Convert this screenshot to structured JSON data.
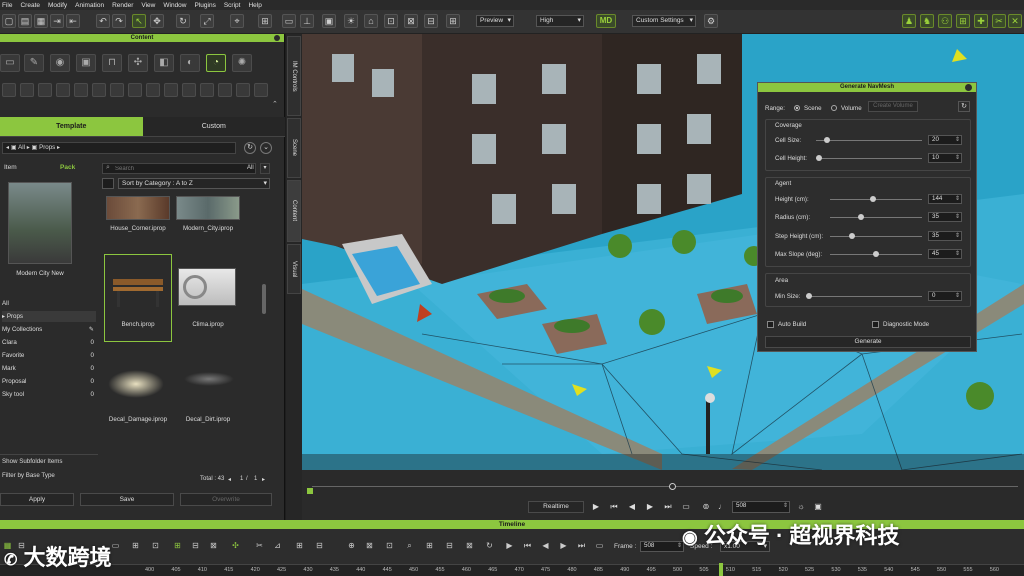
{
  "menu": [
    "File",
    "Create",
    "Modify",
    "Animation",
    "Render",
    "View",
    "Window",
    "Plugins",
    "Script",
    "Help"
  ],
  "toolbar": {
    "render_mode": "Preview",
    "quality": "High",
    "settings": "Custom Settings",
    "logo": "MD"
  },
  "content_panel": {
    "title": "Content",
    "tabs": [
      "Template",
      "Custom"
    ],
    "breadcrumb": [
      "All",
      "Props"
    ],
    "view_tabs": [
      "Item",
      "Pack"
    ],
    "search_placeholder": "Search",
    "search_filter": "All",
    "sort": "Sort by Category : A to Z",
    "preview_label": "Modern City New",
    "tree": [
      {
        "label": "All",
        "count": ""
      },
      {
        "label": "Props",
        "count": ""
      },
      {
        "label": "My Collections",
        "count": ""
      },
      {
        "label": "Clara",
        "count": "0"
      },
      {
        "label": "Favorite",
        "count": "0"
      },
      {
        "label": "Mark",
        "count": "0"
      },
      {
        "label": "Proposal",
        "count": "0"
      },
      {
        "label": "Sky tool",
        "count": "0"
      }
    ],
    "items": [
      {
        "label": "House_Corner.iprop"
      },
      {
        "label": "Modern_City.iprop"
      },
      {
        "label": "Bench.iprop"
      },
      {
        "label": "Clima.iprop"
      },
      {
        "label": "Decal_Damage.iprop"
      },
      {
        "label": "Decal_Dirt.iprop"
      }
    ],
    "show_subfolder": "Show Subfolder Items",
    "filter_base": "Filter by Base Type",
    "total": "Total : 43",
    "page": "1",
    "pages": "1",
    "page_sep": "/",
    "buttons": {
      "apply": "Apply",
      "save": "Save",
      "overwrite": "Overwrite"
    }
  },
  "side_tabs": [
    "IM Controls",
    "Scene",
    "Content",
    "Visual"
  ],
  "navmesh": {
    "title": "Generate NavMesh",
    "range_label": "Range:",
    "range_options": [
      "Scene",
      "Volume"
    ],
    "create_volume": "Create Volume",
    "coverage_title": "Coverage",
    "coverage": [
      {
        "label": "Cell Size:",
        "value": "20",
        "frac": 0.08
      },
      {
        "label": "Cell Height:",
        "value": "10",
        "frac": 0.0
      }
    ],
    "agent_title": "Agent",
    "agent": [
      {
        "label": "Height (cm):",
        "value": "144",
        "frac": 0.47
      },
      {
        "label": "Radius (cm):",
        "value": "35",
        "frac": 0.33
      },
      {
        "label": "Step Height (cm):",
        "value": "35",
        "frac": 0.22
      },
      {
        "label": "Max Slope (deg):",
        "value": "45",
        "frac": 0.5
      }
    ],
    "area_title": "Area",
    "area": [
      {
        "label": "Min Size:",
        "value": "0",
        "frac": 0.0
      }
    ],
    "auto_build": "Auto Build",
    "diagnostic": "Diagnostic Mode",
    "generate": "Generate"
  },
  "playback": {
    "mode": "Realtime",
    "frame": "508",
    "progress": 0.51
  },
  "timeline": {
    "title": "Timeline",
    "frame_label": "Frame :",
    "frame_value": "508",
    "speed_label": "Speed :",
    "speed_value": "x1.00",
    "ruler": [
      "400",
      "405",
      "410",
      "415",
      "420",
      "425",
      "430",
      "435",
      "440",
      "445",
      "450",
      "455",
      "460",
      "465",
      "470",
      "475",
      "480",
      "485",
      "490",
      "495",
      "500",
      "505",
      "510",
      "515",
      "520",
      "525",
      "530",
      "535",
      "540",
      "545",
      "550",
      "555",
      "560"
    ]
  },
  "watermarks": {
    "left": "大数跨境",
    "right": "公众号 · 超视界科技"
  },
  "colors": {
    "accent": "#8cc63f",
    "water": "#2aa3c8",
    "panel": "#2b2b2b"
  }
}
